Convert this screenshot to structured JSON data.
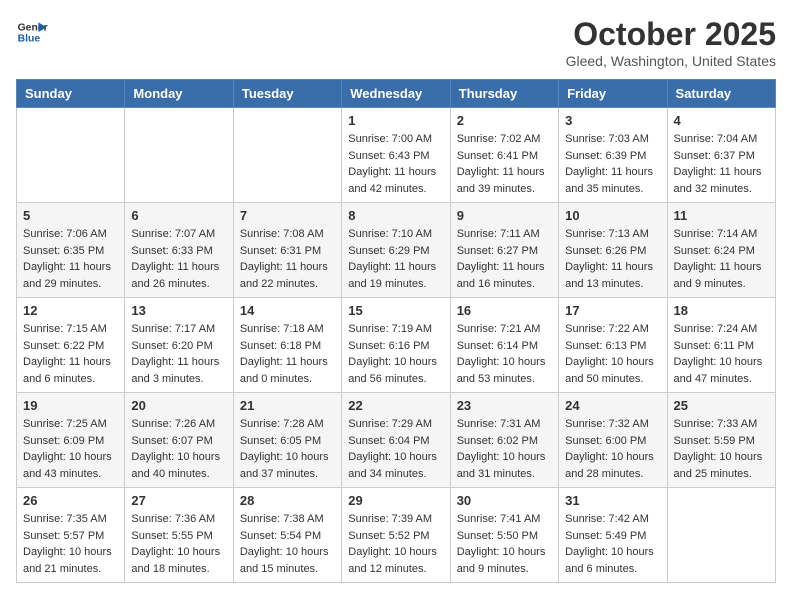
{
  "header": {
    "logo_line1": "General",
    "logo_line2": "Blue",
    "month": "October 2025",
    "location": "Gleed, Washington, United States"
  },
  "days_of_week": [
    "Sunday",
    "Monday",
    "Tuesday",
    "Wednesday",
    "Thursday",
    "Friday",
    "Saturday"
  ],
  "weeks": [
    [
      {
        "day": "",
        "info": ""
      },
      {
        "day": "",
        "info": ""
      },
      {
        "day": "",
        "info": ""
      },
      {
        "day": "1",
        "info": "Sunrise: 7:00 AM\nSunset: 6:43 PM\nDaylight: 11 hours\nand 42 minutes."
      },
      {
        "day": "2",
        "info": "Sunrise: 7:02 AM\nSunset: 6:41 PM\nDaylight: 11 hours\nand 39 minutes."
      },
      {
        "day": "3",
        "info": "Sunrise: 7:03 AM\nSunset: 6:39 PM\nDaylight: 11 hours\nand 35 minutes."
      },
      {
        "day": "4",
        "info": "Sunrise: 7:04 AM\nSunset: 6:37 PM\nDaylight: 11 hours\nand 32 minutes."
      }
    ],
    [
      {
        "day": "5",
        "info": "Sunrise: 7:06 AM\nSunset: 6:35 PM\nDaylight: 11 hours\nand 29 minutes."
      },
      {
        "day": "6",
        "info": "Sunrise: 7:07 AM\nSunset: 6:33 PM\nDaylight: 11 hours\nand 26 minutes."
      },
      {
        "day": "7",
        "info": "Sunrise: 7:08 AM\nSunset: 6:31 PM\nDaylight: 11 hours\nand 22 minutes."
      },
      {
        "day": "8",
        "info": "Sunrise: 7:10 AM\nSunset: 6:29 PM\nDaylight: 11 hours\nand 19 minutes."
      },
      {
        "day": "9",
        "info": "Sunrise: 7:11 AM\nSunset: 6:27 PM\nDaylight: 11 hours\nand 16 minutes."
      },
      {
        "day": "10",
        "info": "Sunrise: 7:13 AM\nSunset: 6:26 PM\nDaylight: 11 hours\nand 13 minutes."
      },
      {
        "day": "11",
        "info": "Sunrise: 7:14 AM\nSunset: 6:24 PM\nDaylight: 11 hours\nand 9 minutes."
      }
    ],
    [
      {
        "day": "12",
        "info": "Sunrise: 7:15 AM\nSunset: 6:22 PM\nDaylight: 11 hours\nand 6 minutes."
      },
      {
        "day": "13",
        "info": "Sunrise: 7:17 AM\nSunset: 6:20 PM\nDaylight: 11 hours\nand 3 minutes."
      },
      {
        "day": "14",
        "info": "Sunrise: 7:18 AM\nSunset: 6:18 PM\nDaylight: 11 hours\nand 0 minutes."
      },
      {
        "day": "15",
        "info": "Sunrise: 7:19 AM\nSunset: 6:16 PM\nDaylight: 10 hours\nand 56 minutes."
      },
      {
        "day": "16",
        "info": "Sunrise: 7:21 AM\nSunset: 6:14 PM\nDaylight: 10 hours\nand 53 minutes."
      },
      {
        "day": "17",
        "info": "Sunrise: 7:22 AM\nSunset: 6:13 PM\nDaylight: 10 hours\nand 50 minutes."
      },
      {
        "day": "18",
        "info": "Sunrise: 7:24 AM\nSunset: 6:11 PM\nDaylight: 10 hours\nand 47 minutes."
      }
    ],
    [
      {
        "day": "19",
        "info": "Sunrise: 7:25 AM\nSunset: 6:09 PM\nDaylight: 10 hours\nand 43 minutes."
      },
      {
        "day": "20",
        "info": "Sunrise: 7:26 AM\nSunset: 6:07 PM\nDaylight: 10 hours\nand 40 minutes."
      },
      {
        "day": "21",
        "info": "Sunrise: 7:28 AM\nSunset: 6:05 PM\nDaylight: 10 hours\nand 37 minutes."
      },
      {
        "day": "22",
        "info": "Sunrise: 7:29 AM\nSunset: 6:04 PM\nDaylight: 10 hours\nand 34 minutes."
      },
      {
        "day": "23",
        "info": "Sunrise: 7:31 AM\nSunset: 6:02 PM\nDaylight: 10 hours\nand 31 minutes."
      },
      {
        "day": "24",
        "info": "Sunrise: 7:32 AM\nSunset: 6:00 PM\nDaylight: 10 hours\nand 28 minutes."
      },
      {
        "day": "25",
        "info": "Sunrise: 7:33 AM\nSunset: 5:59 PM\nDaylight: 10 hours\nand 25 minutes."
      }
    ],
    [
      {
        "day": "26",
        "info": "Sunrise: 7:35 AM\nSunset: 5:57 PM\nDaylight: 10 hours\nand 21 minutes."
      },
      {
        "day": "27",
        "info": "Sunrise: 7:36 AM\nSunset: 5:55 PM\nDaylight: 10 hours\nand 18 minutes."
      },
      {
        "day": "28",
        "info": "Sunrise: 7:38 AM\nSunset: 5:54 PM\nDaylight: 10 hours\nand 15 minutes."
      },
      {
        "day": "29",
        "info": "Sunrise: 7:39 AM\nSunset: 5:52 PM\nDaylight: 10 hours\nand 12 minutes."
      },
      {
        "day": "30",
        "info": "Sunrise: 7:41 AM\nSunset: 5:50 PM\nDaylight: 10 hours\nand 9 minutes."
      },
      {
        "day": "31",
        "info": "Sunrise: 7:42 AM\nSunset: 5:49 PM\nDaylight: 10 hours\nand 6 minutes."
      },
      {
        "day": "",
        "info": ""
      }
    ]
  ]
}
